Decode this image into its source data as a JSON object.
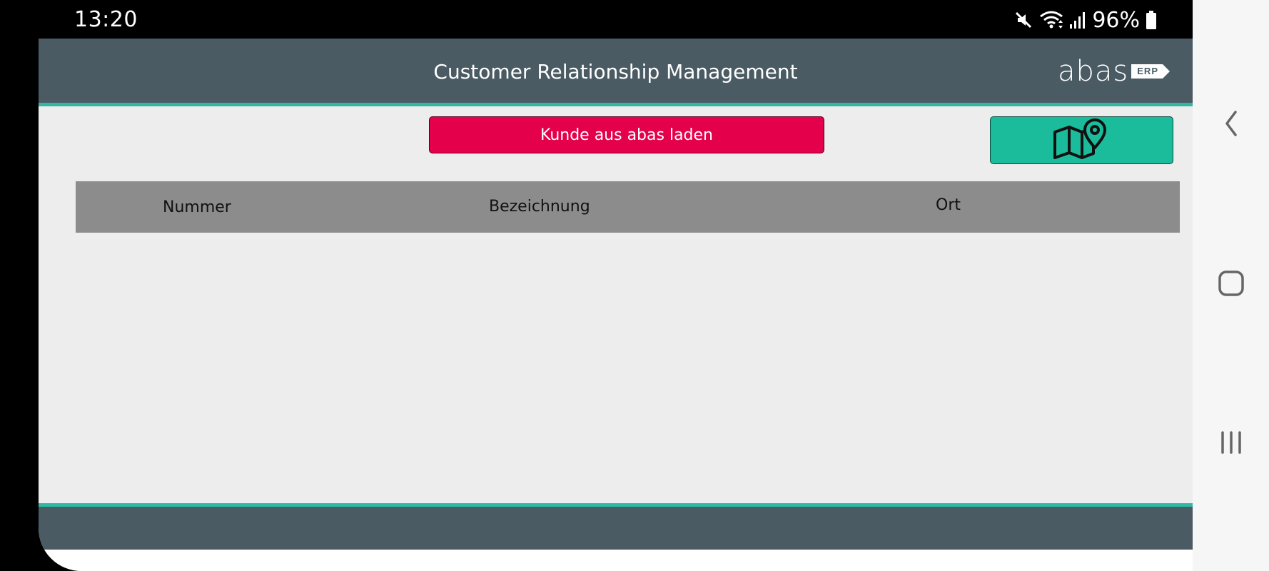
{
  "status_bar": {
    "time": "13:20",
    "battery_percent": "96%",
    "icons": [
      "mute-icon",
      "wifi-icon",
      "signal-icon",
      "battery-icon"
    ]
  },
  "header": {
    "title": "Customer Relationship Management",
    "brand": {
      "name": "abas",
      "tag": "ERP"
    }
  },
  "toolbar": {
    "load_button_label": "Kunde aus abas laden",
    "map_button_icon": "map-pin-icon"
  },
  "table": {
    "columns": [
      "Nummer",
      "Bezeichnung",
      "Ort"
    ],
    "rows": []
  },
  "nav_bar": {
    "buttons": [
      "back-icon",
      "home-icon",
      "recents-icon"
    ]
  },
  "colors": {
    "header_bg": "#4a5b63",
    "accent_line": "#31b8a5",
    "load_button": "#e4004b",
    "map_button": "#1abc9c",
    "table_header": "#8c8c8c",
    "content_bg": "#ededed"
  }
}
